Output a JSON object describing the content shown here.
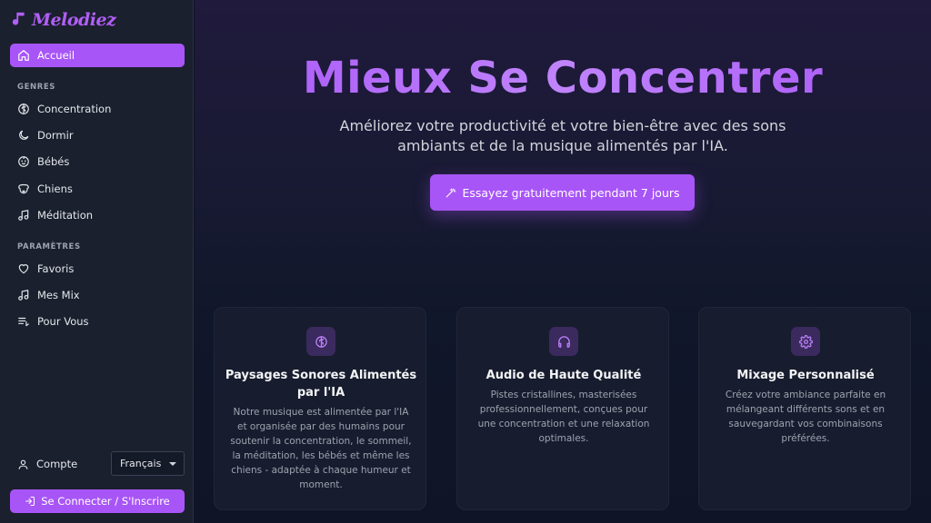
{
  "app": {
    "name": "Melodiez"
  },
  "sidebar": {
    "home": {
      "label": "Accueil"
    },
    "genres_title": "GENRES",
    "genres": [
      {
        "label": "Concentration",
        "icon": "brain-icon"
      },
      {
        "label": "Dormir",
        "icon": "moon-icon"
      },
      {
        "label": "Bébés",
        "icon": "baby-icon"
      },
      {
        "label": "Chiens",
        "icon": "dog-icon"
      },
      {
        "label": "Méditation",
        "icon": "music-note-icon"
      }
    ],
    "settings_title": "PARAMÈTRES",
    "settings": [
      {
        "label": "Favoris",
        "icon": "heart-icon"
      },
      {
        "label": "Mes Mix",
        "icon": "music-note-icon"
      },
      {
        "label": "Pour Vous",
        "icon": "playlist-icon"
      }
    ],
    "account_label": "Compte",
    "language": "Français",
    "login_label": "Se Connecter / S'Inscrire"
  },
  "hero": {
    "title": "Mieux Se Concentrer",
    "subtitle": "Améliorez votre productivité et votre bien-être avec des sons ambiants et de la musique alimentés par l'IA.",
    "cta_label": "Essayez gratuitement pendant 7 jours"
  },
  "features": [
    {
      "icon": "brain-icon",
      "title": "Paysages Sonores Alimentés par l'IA",
      "text": "Notre musique est alimentée par l'IA et organisée par des humains pour soutenir la concentration, le sommeil, la méditation, les bébés et même les chiens - adaptée à chaque humeur et moment."
    },
    {
      "icon": "headphones-icon",
      "title": "Audio de Haute Qualité",
      "text": "Pistes cristallines, masterisées professionnellement, conçues pour une concentration et une relaxation optimales."
    },
    {
      "icon": "gear-icon",
      "title": "Mixage Personnalisé",
      "text": "Créez votre ambiance parfaite en mélangeant différents sons et en sauvegardant vos combinaisons préférées."
    }
  ],
  "colors": {
    "accent": "#a855f7",
    "sidebar_bg": "#1a202e",
    "card_bg": "#171d2e"
  }
}
